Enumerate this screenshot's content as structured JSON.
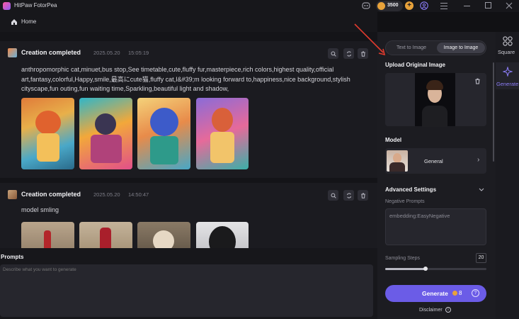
{
  "app": {
    "title": "HitPaw FotorPea",
    "coins": "3500"
  },
  "nav": {
    "home_label": "Home"
  },
  "feed": {
    "cards": [
      {
        "status": "Creation completed",
        "date": "2025.05.20",
        "time": "15:05:19",
        "prompt": "anthropomorphic cat,minuet,bus stop,See timetable,cute,fluffy fur,masterpiece,rich colors,highest quality,official art,fantasy,colorful,Happy,smile,最高にcute猫,fluffy cat,I&#39;m looking forward to,happiness,nice background,stylish cityscape,fun outing,fun waiting time,Sparkling,beautiful light and shadow,"
      },
      {
        "status": "Creation completed",
        "date": "2025.05.20",
        "time": "14:50:47",
        "prompt": "model smling"
      }
    ]
  },
  "prompts": {
    "label": "Prompts",
    "placeholder": "Describe what you want to generate"
  },
  "panel": {
    "tabs": [
      "Text to Image",
      "Image to Image"
    ],
    "active_tab": "Image to Image",
    "upload_label": "Upload Original Image",
    "model_label": "Model",
    "model_value": "General",
    "advanced_label": "Advanced Settings",
    "negative_label": "Negative Prompts",
    "negative_value": "embedding:EasyNegative",
    "steps_label": "Sampling Steps",
    "steps_value": "20",
    "steps_fraction": 0.4,
    "generate_label": "Generate",
    "generate_cost": "8",
    "disclaimer": "Disclaimer"
  },
  "rail": {
    "items": [
      "Square",
      "Generate"
    ]
  },
  "colors": {
    "accent": "#6b5ce7",
    "active": "#8b7cf6",
    "coin": "#e8a23a"
  }
}
